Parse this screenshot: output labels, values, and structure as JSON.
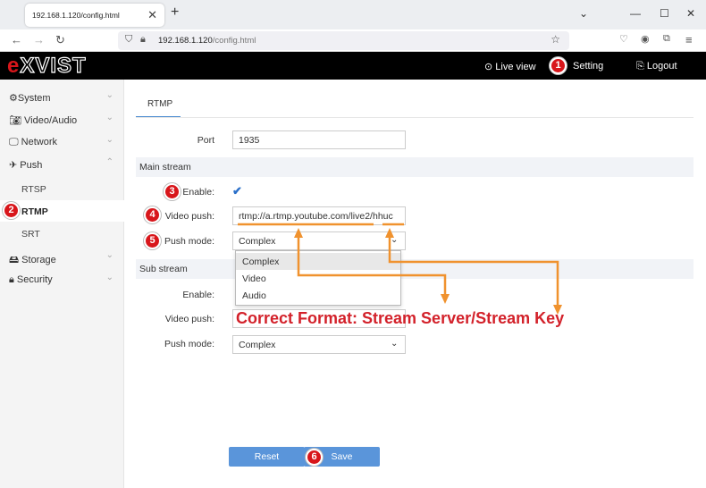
{
  "browser": {
    "tab_title": "192.168.1.120/config.html",
    "url_host": "192.168.1.120",
    "url_path": "/config.html"
  },
  "header": {
    "logo_text": "EXVIST",
    "live_view": "Live view",
    "setting": "Setting",
    "logout": "Logout"
  },
  "sidebar": {
    "items": [
      {
        "label": "System"
      },
      {
        "label": "Video/Audio"
      },
      {
        "label": "Network"
      },
      {
        "label": "Push"
      },
      {
        "label": "Storage"
      },
      {
        "label": "Security"
      }
    ],
    "push_sub": [
      "RTSP",
      "RTMP",
      "SRT"
    ]
  },
  "main": {
    "tab": "RTMP",
    "port_label": "Port",
    "port_value": "1935",
    "main_stream": {
      "title": "Main stream",
      "enable_label": "Enable:",
      "enable_checked": true,
      "video_push_label": "Video push:",
      "video_push_value": "rtmp://a.rtmp.youtube.com/live2/hhuc",
      "push_mode_label": "Push mode:",
      "push_mode_value": "Complex"
    },
    "dropdown_options": [
      "Complex",
      "Video",
      "Audio"
    ],
    "sub_stream": {
      "title": "Sub stream",
      "enable_label": "Enable:",
      "video_push_label": "Video push:",
      "push_mode_label": "Push mode:",
      "push_mode_value": "Complex"
    },
    "reset_label": "Reset",
    "save_label": "Save"
  },
  "annotations": {
    "text": "Correct Format: Stream Server/Stream Key",
    "badges": [
      "1",
      "2",
      "3",
      "4",
      "5",
      "6"
    ],
    "color": "#d8161b",
    "arrow_color": "#f0922e"
  }
}
